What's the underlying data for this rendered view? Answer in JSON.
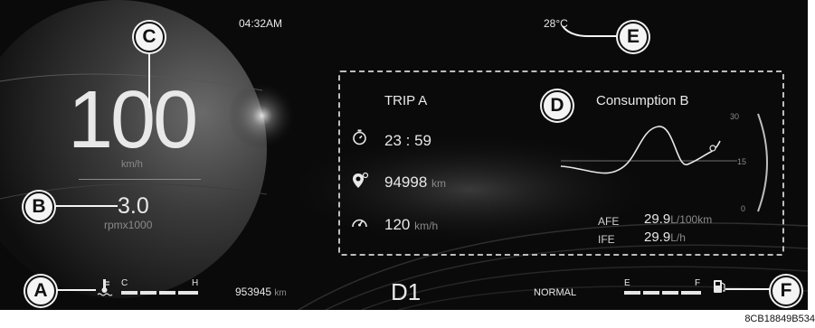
{
  "clock": "04:32AM",
  "outside_temp": "28°C",
  "speed": {
    "value": "100",
    "unit": "km/h"
  },
  "rpm": {
    "value": "3.0",
    "unit": "rpmx1000"
  },
  "trip": {
    "title": "TRIP A",
    "time": "23 : 59",
    "distance": "94998",
    "distance_unit": "km",
    "avg_speed": "120",
    "avg_speed_unit": "km/h"
  },
  "consumption": {
    "title": "Consumption B",
    "scale_max": "30",
    "scale_mid": "15",
    "scale_min": "0",
    "afe_label": "AFE",
    "afe_value": "29.9",
    "afe_unit": "L/100km",
    "ife_label": "IFE",
    "ife_value": "29.9",
    "ife_unit": "L/h"
  },
  "coolant": {
    "low": "C",
    "high": "H"
  },
  "fuel": {
    "low": "E",
    "high": "F"
  },
  "odometer": {
    "value": "953945",
    "unit": "km"
  },
  "gear": "D1",
  "drive_mode": "NORMAL",
  "callouts": {
    "a": "A",
    "b": "B",
    "c": "C",
    "d": "D",
    "e": "E",
    "f": "F"
  },
  "figure_code": "8CB18849B534",
  "colors": {
    "background": "#0a0a0a",
    "text": "#e8e8e8",
    "dim_text": "#8a8a8a",
    "callout": "#f4f4f4"
  },
  "icons": [
    "thermometer-icon",
    "stopwatch-icon",
    "map-pin-icon",
    "speedometer-icon",
    "fuel-pump-icon"
  ]
}
